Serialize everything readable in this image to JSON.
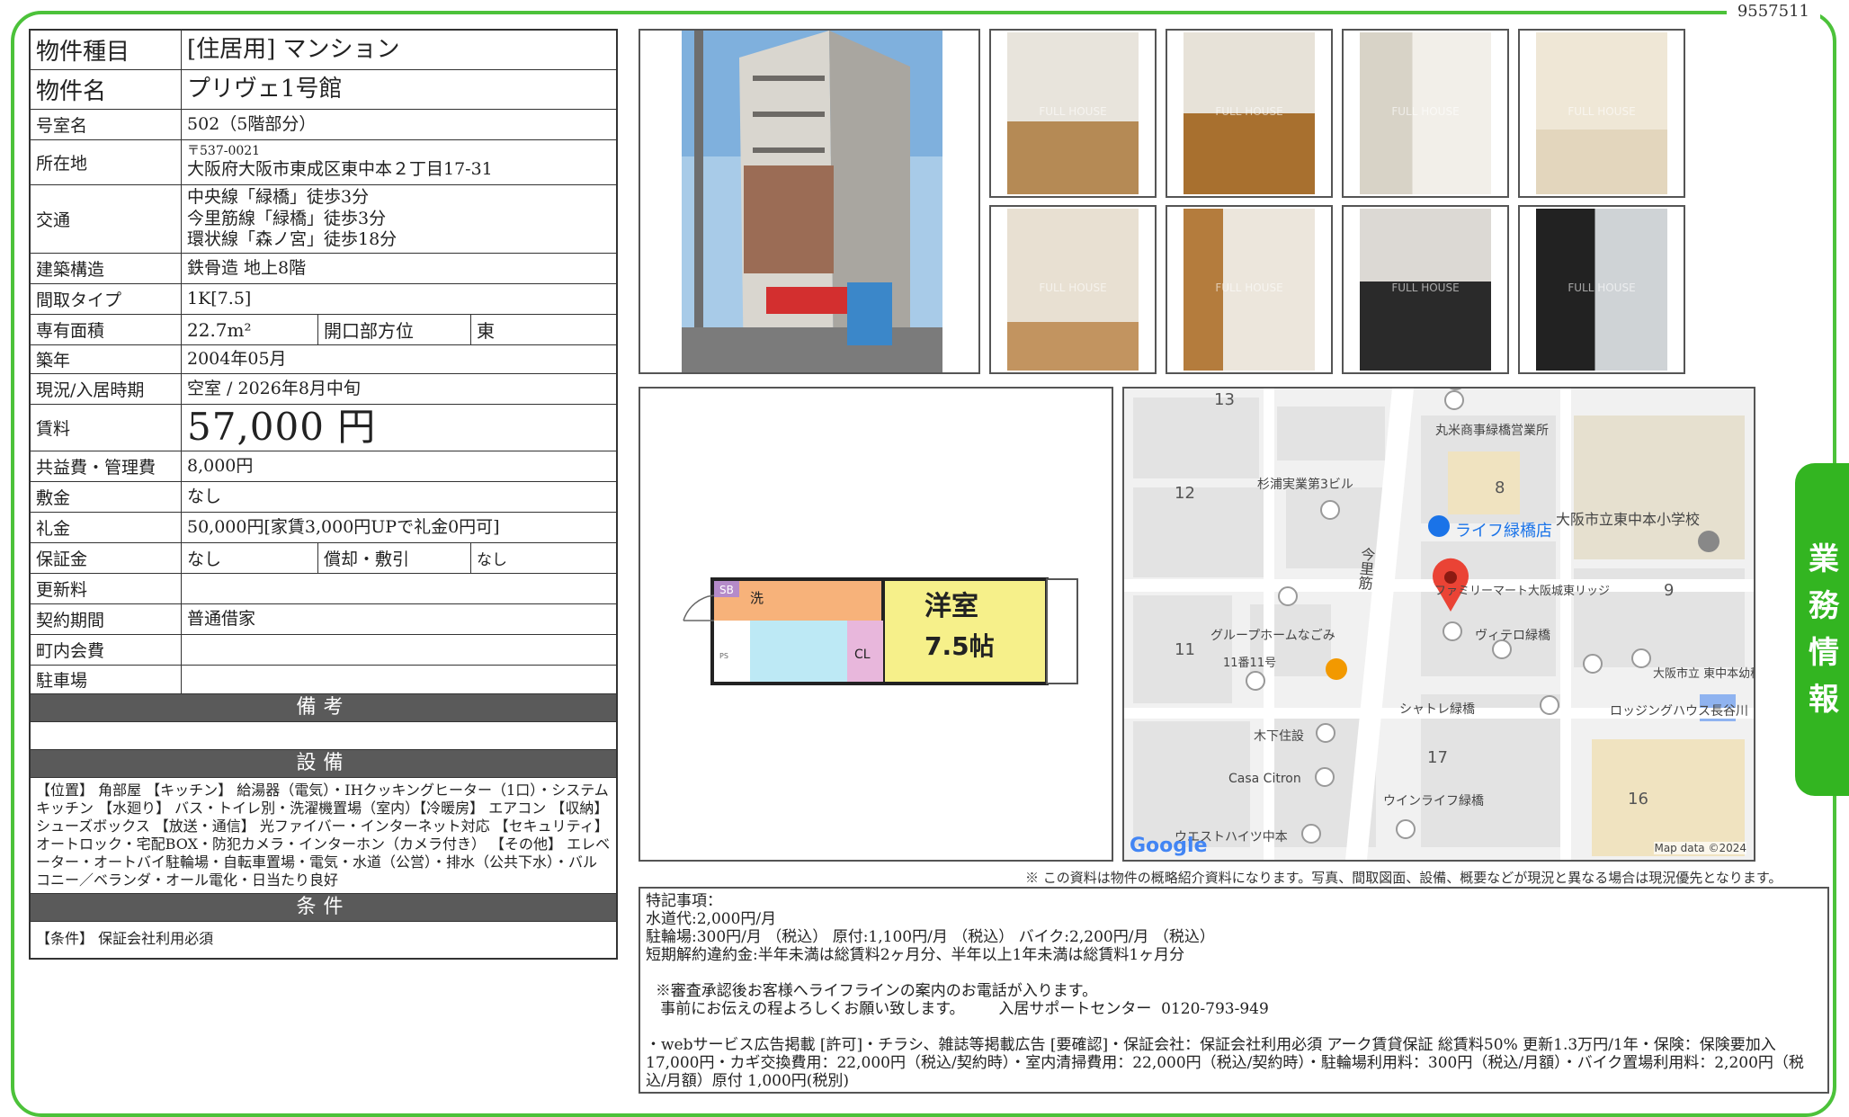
{
  "doc_id": "9557511",
  "property": {
    "type_label": "物件種目",
    "type_value": "[住居用] マンション",
    "name_label": "物件名",
    "name_value": "プリヴェ1号館",
    "room_label": "号室名",
    "room_value": "502（5階部分）",
    "address_label": "所在地",
    "postal": "〒537-0021",
    "address": "大阪府大阪市東成区東中本２丁目17-31",
    "transport_label": "交通",
    "transport": [
      "中央線「緑橋」徒歩3分",
      "今里筋線「緑橋」徒歩3分",
      "環状線「森ノ宮」徒歩18分"
    ],
    "structure_label": "建築構造",
    "structure_value": "鉄骨造 地上8階",
    "layout_label": "間取タイプ",
    "layout_value": "1K[7.5]",
    "area_label": "専有面積",
    "area_value": "22.7m²",
    "direction_label": "開口部方位",
    "direction_value": "東",
    "built_label": "築年",
    "built_value": "2004年05月",
    "status_label": "現況/入居時期",
    "status_value": "空室 / 2026年8月中旬",
    "rent_label": "賃料",
    "rent_value": "57,000 円",
    "fee_label": "共益費・管理費",
    "fee_value": "8,000円",
    "deposit_label": "敷金",
    "deposit_value": "なし",
    "key_money_label": "礼金",
    "key_money_value": "50,000円[家賃3,000円UPで礼金0円可]",
    "guarantee_label": "保証金",
    "guarantee_value": "なし",
    "amort_label": "償却・敷引",
    "amort_value": "なし",
    "renewal_label": "更新料",
    "renewal_value": "",
    "contract_label": "契約期間",
    "contract_value": "普通借家",
    "community_label": "町内会費",
    "community_value": "",
    "parking_label": "駐車場",
    "parking_value": ""
  },
  "remarks_header": "備考",
  "equipment_header": "設備",
  "equipment_text": "【位置】 角部屋 【キッチン】 給湯器（電気）・IHクッキングヒーター（1口）・システムキッチン 【水廻り】 バス・トイレ別・洗濯機置場（室内）【冷暖房】 エアコン 【収納】 シューズボックス 【放送・通信】 光ファイバー・インターネット対応 【セキュリティ】 オートロック・宅配BOX・防犯カメラ・インターホン（カメラ付き） 【その他】 エレベーター・オートバイ駐輪場・自転車置場・電気・水道（公営）・排水（公共下水）・バルコニー／ベランダ・オール電化・日当たり良好",
  "conditions_header": "条件",
  "conditions_text": "【条件】 保証会社利用必須",
  "photo_watermark": "FULL HOUSE",
  "floorplan": {
    "room_label": "洋室",
    "size_label": "7.5帖",
    "closet": "CL",
    "wash": "洗",
    "sb": "SB",
    "ps": "PS"
  },
  "map": {
    "labels": [
      "丸米商事緑橋営業所",
      "杉浦実業第3ビル",
      "ライフ緑橋店",
      "大阪市立東中本小学校",
      "ファミリーマート大阪城東リッジ",
      "グループホームなごみ",
      "ヴィテロ緑橋",
      "11番11号",
      "シャトレ緑橋",
      "ロッジングハウス長谷川",
      "大阪市立 東中本幼稚園",
      "木下住設",
      "Casa Citron",
      "ウインライフ緑橋",
      "ウエストハイツ中本"
    ],
    "road": "今里筋",
    "block_numbers": [
      "13",
      "12",
      "8",
      "9",
      "11",
      "17",
      "16"
    ],
    "brand": "Google",
    "attribution": "Map data ©2024"
  },
  "disclaimer": "※ この資料は物件の概略紹介資料になります。写真、間取図面、設備、概要などが現況と異なる場合は現況優先となります。",
  "notes": [
    "特記事項：",
    "水道代:2,000円/月",
    "駐輪場:300円/月 （税込） 原付:1,100円/月 （税込） バイク:2,200円/月 （税込）",
    "短期解約違約金:半年未満は総賃料2ヶ月分、半年以上1年未満は総賃料1ヶ月分",
    "",
    "  ※審査承認後お客様へライフラインの案内のお電話が入ります。",
    "   事前にお伝えの程よろしくお願い致します。       入居サポートセンター  0120-793-949",
    "",
    "・webサービス広告掲載 [許可]・チラシ、雑誌等掲載広告 [要確認]・保証会社：保証会社利用必須 アーク賃貸保証 総賃料50% 更新1.3万円/1年・保険：保険要加入 17,000円・カギ交換費用：22,000円（税込/契約時）・室内清掃費用：22,000円（税込/契約時）・駐輪場利用料：300円（税込/月額）・バイク置場利用料：2,200円（税込/月額）原付 1,000円(税別)"
  ],
  "side_tab": [
    "業",
    "務",
    "情",
    "報"
  ]
}
